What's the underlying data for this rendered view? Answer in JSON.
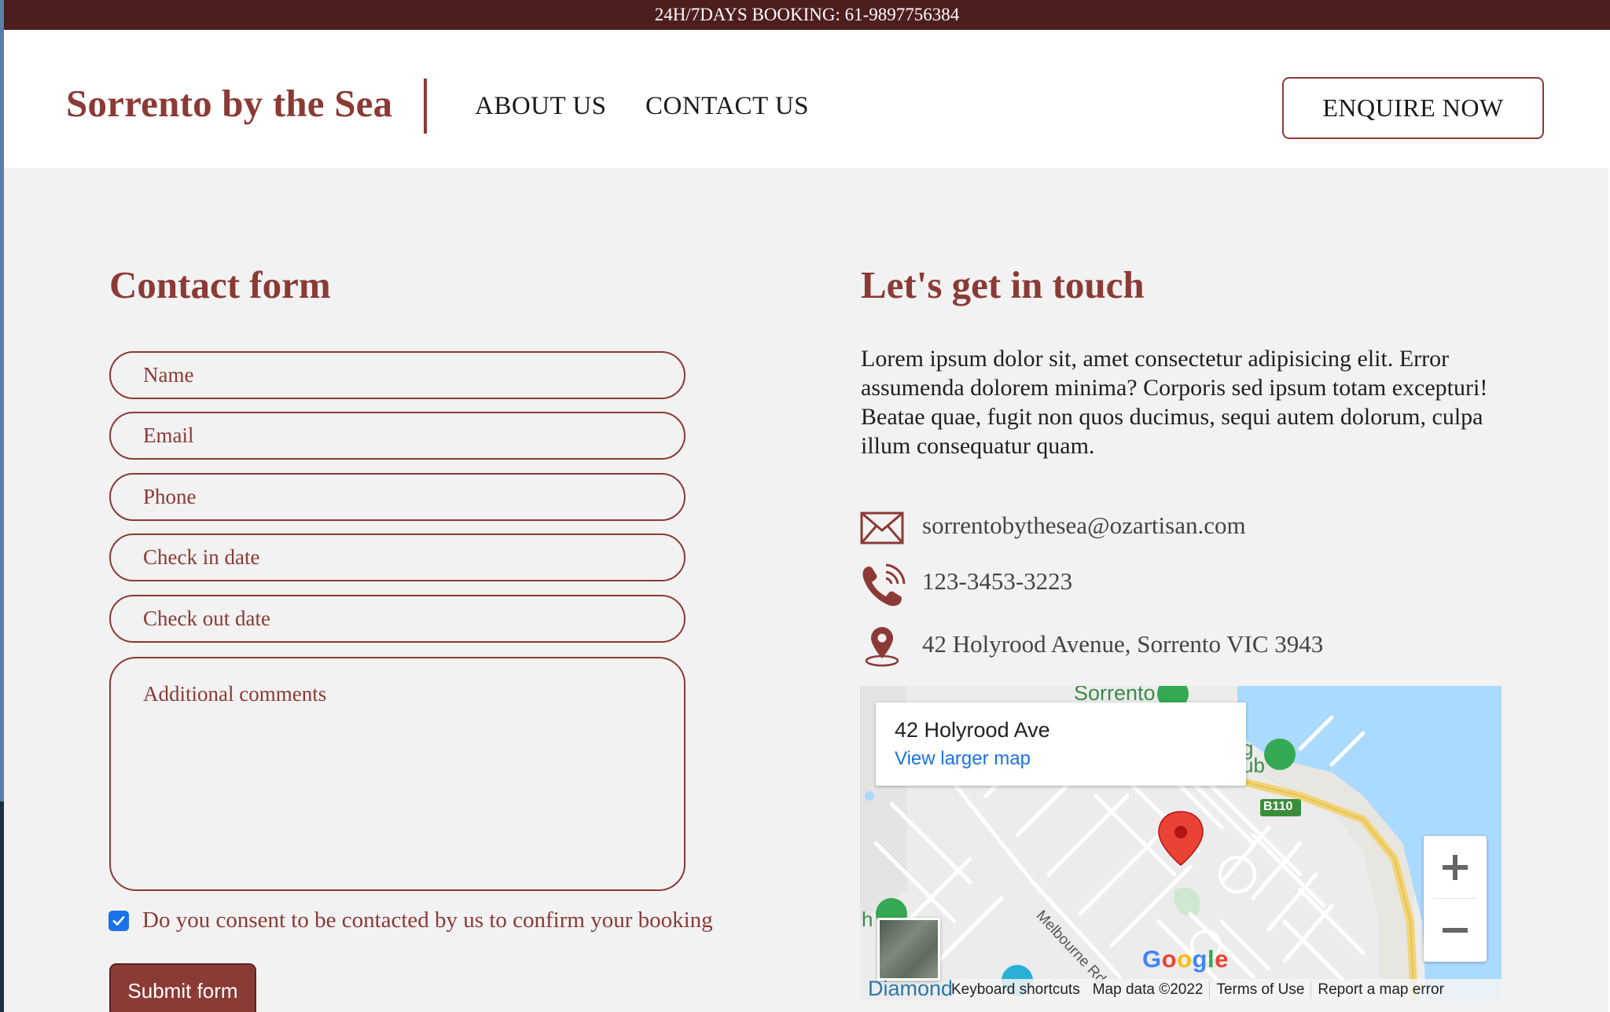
{
  "topbar": {
    "text": "24H/7DAYS BOOKING: 61-9897756384"
  },
  "nav": {
    "logo": "Sorrento by the Sea",
    "links": [
      "ABOUT US",
      "CONTACT US"
    ],
    "enquire": "ENQUIRE NOW"
  },
  "form": {
    "title": "Contact form",
    "placeholders": {
      "name": "Name",
      "email": "Email",
      "phone": "Phone",
      "check_in": "Check in date",
      "check_out": "Check out date",
      "comments": "Additional comments"
    },
    "consent_label": "Do you consent to be contacted by us to confirm your booking",
    "consent_checked": true,
    "submit": "Submit form"
  },
  "touch": {
    "title": "Let's get in touch",
    "intro": "Lorem ipsum dolor sit, amet consectetur adipisicing elit. Error assumenda dolorem minima? Corporis sed ipsum totam excepturi! Beatae quae, fugit non quos ducimus, sequi autem dolorum, culpa illum consequatur quam.",
    "email": "sorrentobythesea@ozartisan.com",
    "phone": "123-3453-3223",
    "address": "42 Holyrood Avenue, Sorrento VIC 3943",
    "icons": [
      "envelope-icon",
      "phone-icon",
      "location-pin-icon"
    ]
  },
  "map": {
    "place_name": "42 Holyrood Ave",
    "view_larger": "View larger map",
    "labels": {
      "town": "Sorrento",
      "road": "Melbourne Rd",
      "route": "B110",
      "partial_club": "g\nub",
      "partial_left": "h",
      "partial_bottom": "Diamond"
    },
    "logo": "Google",
    "footer": {
      "shortcuts": "Keyboard shortcuts",
      "data": "Map data ©2022",
      "terms": "Terms of Use",
      "report": "Report a map error"
    }
  },
  "colors": {
    "brand": "#8b3a35",
    "topbar": "#4e1e1e",
    "page_bg": "#f2f2f2",
    "map_water": "#aadaff",
    "check_blue": "#1a73e8"
  }
}
